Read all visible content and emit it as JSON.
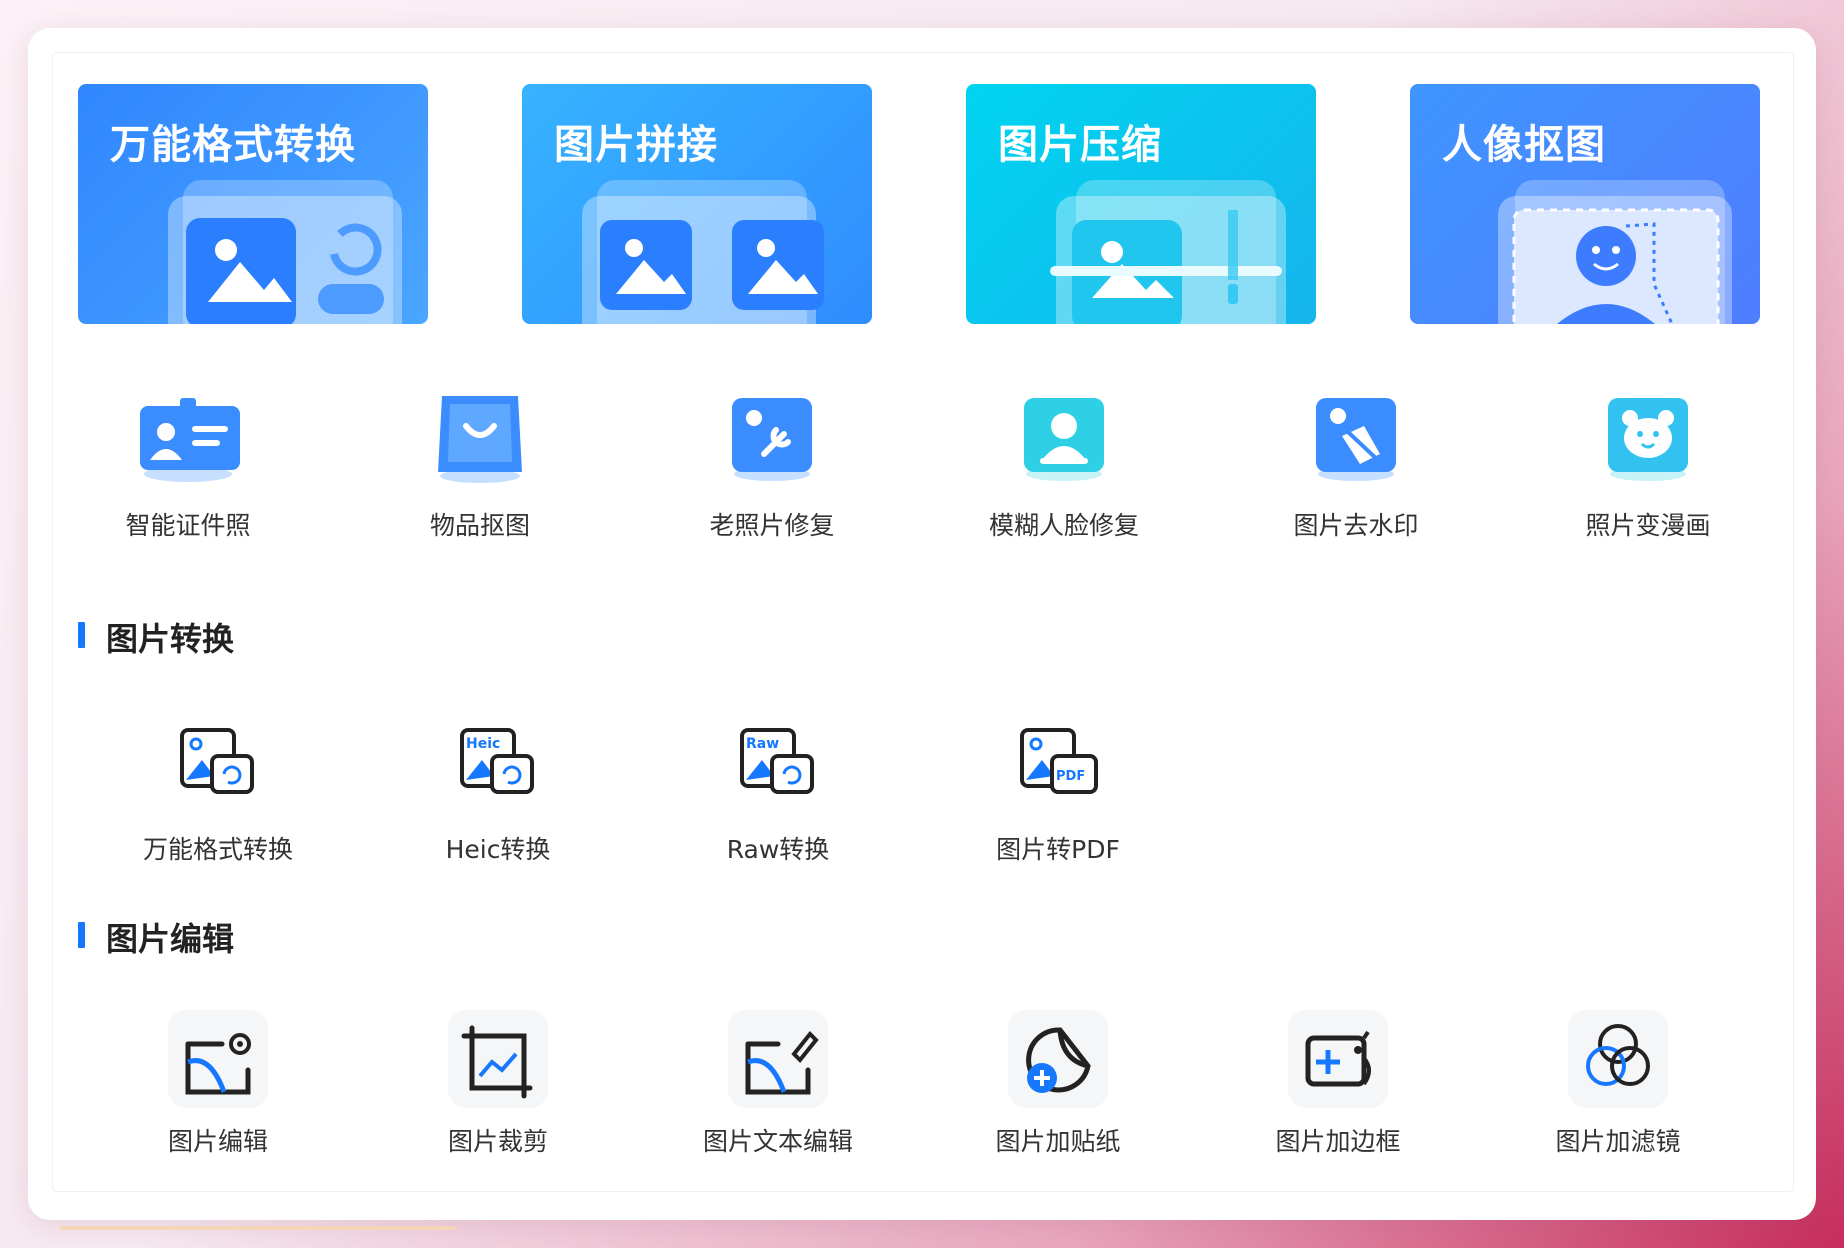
{
  "banners": [
    {
      "title": "万能格式转换",
      "colors": [
        "#2f86ff",
        "#4aa6ff"
      ]
    },
    {
      "title": "图片拼接",
      "colors": [
        "#37b3ff",
        "#2f8cff"
      ]
    },
    {
      "title": "图片压缩",
      "colors": [
        "#00d4f0",
        "#16b5ec"
      ]
    },
    {
      "title": "人像抠图",
      "colors": [
        "#3f95ff",
        "#4f7dff"
      ]
    }
  ],
  "features": [
    {
      "label": "智能证件照",
      "icon": "id-card-icon"
    },
    {
      "label": "物品抠图",
      "icon": "shopping-bag-icon"
    },
    {
      "label": "老照片修复",
      "icon": "photo-wrench-icon"
    },
    {
      "label": "模糊人脸修复",
      "icon": "person-portrait-icon"
    },
    {
      "label": "图片去水印",
      "icon": "erase-watermark-icon"
    },
    {
      "label": "照片变漫画",
      "icon": "bear-face-icon"
    }
  ],
  "sections": {
    "convert": {
      "title": "图片转换",
      "items": [
        {
          "label": "万能格式转换",
          "icon": "format-convert-icon"
        },
        {
          "label": "Heic转换",
          "icon": "heic-convert-icon",
          "badge": "Heic"
        },
        {
          "label": "Raw转换",
          "icon": "raw-convert-icon",
          "badge": "Raw"
        },
        {
          "label": "图片转PDF",
          "icon": "image-to-pdf-icon",
          "badge": "PDF"
        }
      ]
    },
    "edit": {
      "title": "图片编辑",
      "items": [
        {
          "label": "图片编辑",
          "icon": "image-settings-icon"
        },
        {
          "label": "图片裁剪",
          "icon": "crop-icon"
        },
        {
          "label": "图片文本编辑",
          "icon": "image-text-edit-icon"
        },
        {
          "label": "图片加贴纸",
          "icon": "sticker-icon"
        },
        {
          "label": "图片加边框",
          "icon": "frame-icon"
        },
        {
          "label": "图片加滤镜",
          "icon": "filter-icon"
        }
      ]
    }
  },
  "colors": {
    "accent": "#1677ff",
    "text": "#333333"
  }
}
